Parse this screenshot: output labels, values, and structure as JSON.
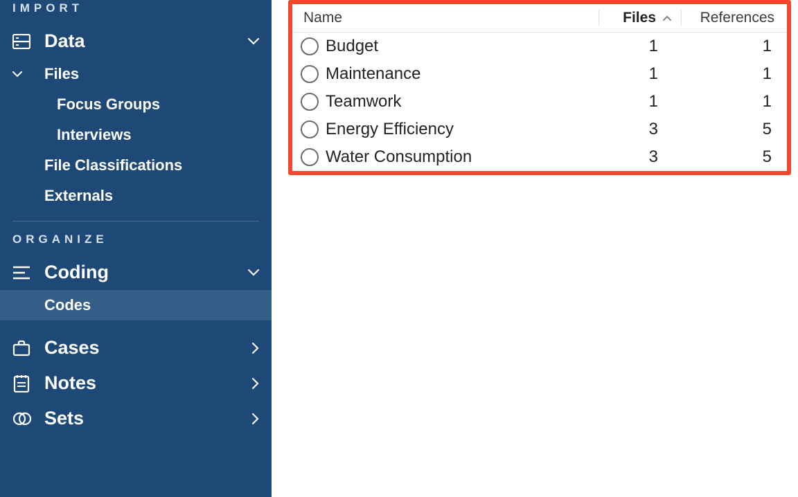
{
  "sidebar": {
    "sections": {
      "import": {
        "label": "IMPORT"
      },
      "organize": {
        "label": "ORGANIZE"
      }
    },
    "data": {
      "label": "Data",
      "files": {
        "label": "Files",
        "children": {
          "focus_groups": "Focus Groups",
          "interviews": "Interviews"
        }
      },
      "file_classifications": "File Classifications",
      "externals": "Externals"
    },
    "coding": {
      "label": "Coding",
      "codes": "Codes"
    },
    "cases": "Cases",
    "notes": "Notes",
    "sets": "Sets"
  },
  "table": {
    "columns": {
      "name": "Name",
      "files": "Files",
      "references": "References"
    },
    "sort": {
      "column": "files",
      "direction": "asc"
    },
    "rows": [
      {
        "name": "Budget",
        "files": 1,
        "references": 1
      },
      {
        "name": "Maintenance",
        "files": 1,
        "references": 1
      },
      {
        "name": "Teamwork",
        "files": 1,
        "references": 1
      },
      {
        "name": "Energy Efficiency",
        "files": 3,
        "references": 5
      },
      {
        "name": "Water Consumption",
        "files": 3,
        "references": 5
      }
    ]
  }
}
